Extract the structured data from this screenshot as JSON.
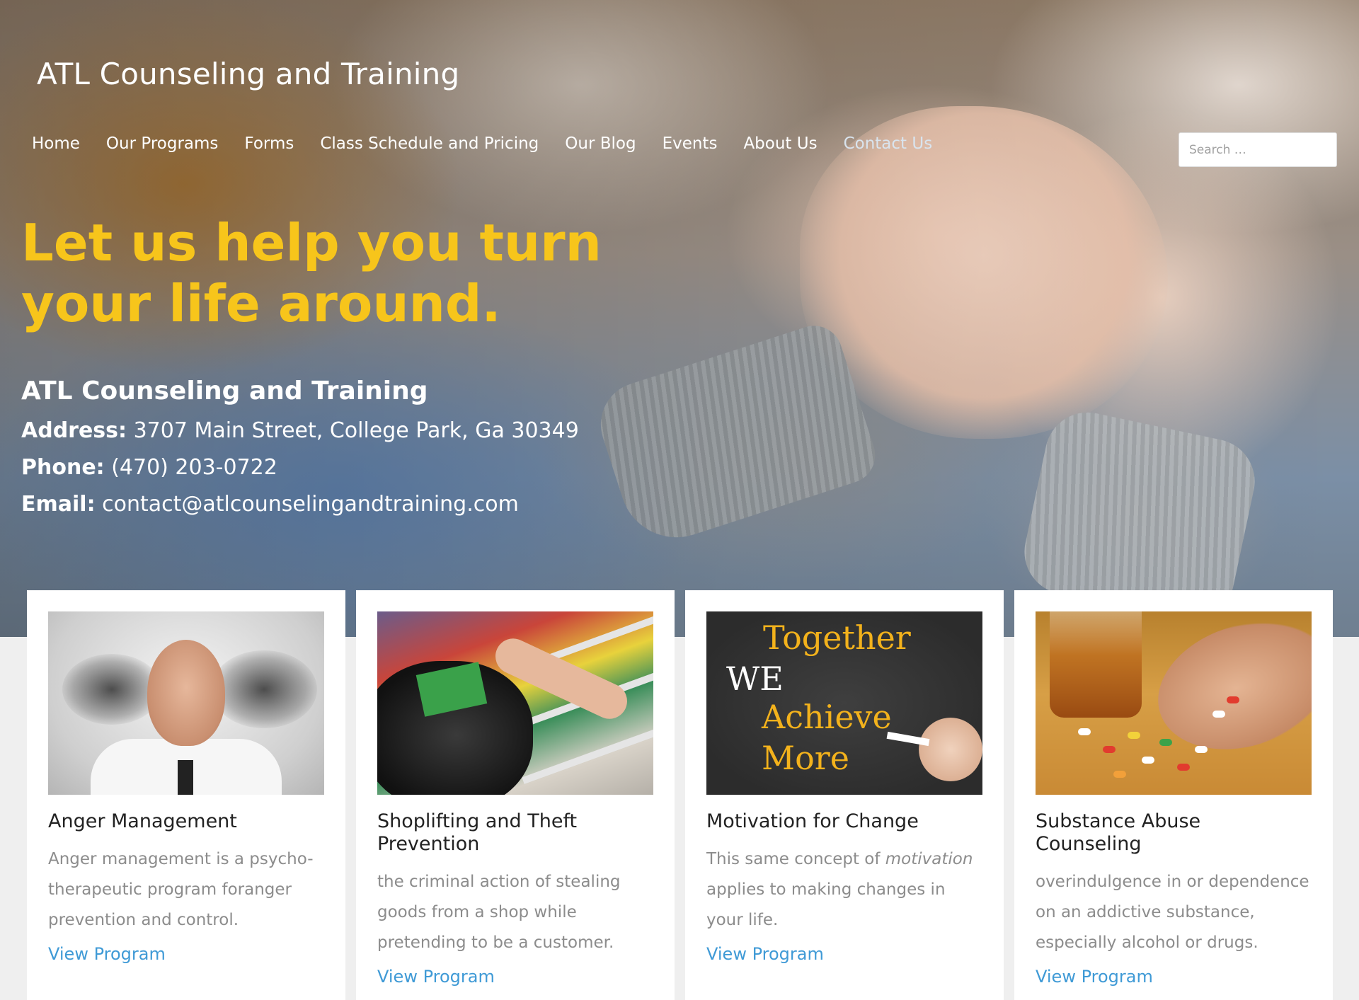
{
  "header": {
    "site_title": "ATL Counseling and Training",
    "nav": [
      {
        "label": "Home"
      },
      {
        "label": "Our Programs"
      },
      {
        "label": "Forms"
      },
      {
        "label": "Class Schedule and Pricing"
      },
      {
        "label": "Our Blog"
      },
      {
        "label": "Events"
      },
      {
        "label": "About Us"
      },
      {
        "label": "Contact Us"
      }
    ],
    "search_placeholder": "Search …"
  },
  "hero": {
    "headline": "Let us help you turn your life around.",
    "org_name": "ATL Counseling and Training",
    "address_label": "Address:",
    "address_value": " 3707 Main Street, College Park, Ga 30349",
    "phone_label": "Phone:",
    "phone_value": " (470) 203-0722",
    "email_label": "Email:",
    "email_value": "contact@atlcounselingandtraining.com"
  },
  "cards": [
    {
      "title": "Anger Management",
      "description": "Anger management is a psycho-therapeutic program foranger prevention and control.",
      "link": "View Program"
    },
    {
      "title": "Shoplifting and Theft Prevention",
      "description": "the criminal action of stealing goods from a shop while pretending to be a customer.",
      "link": "View Program"
    },
    {
      "title": "Motivation for Change",
      "description_before": "This same concept of ",
      "description_em": "motivation",
      "description_after": " applies to making changes in your life.",
      "link": "View Program",
      "image_text": {
        "line1": "Together",
        "line2": "WE",
        "line3": "Achieve",
        "line4": "More"
      }
    },
    {
      "title": "Substance Abuse Counseling",
      "description": "overindulgence in or dependence on an addictive substance, especially alcohol or drugs.",
      "link": "View Program"
    }
  ],
  "colors": {
    "headline": "#f7c51b",
    "link": "#3f9ad6",
    "body_text": "#8c8c8c"
  }
}
